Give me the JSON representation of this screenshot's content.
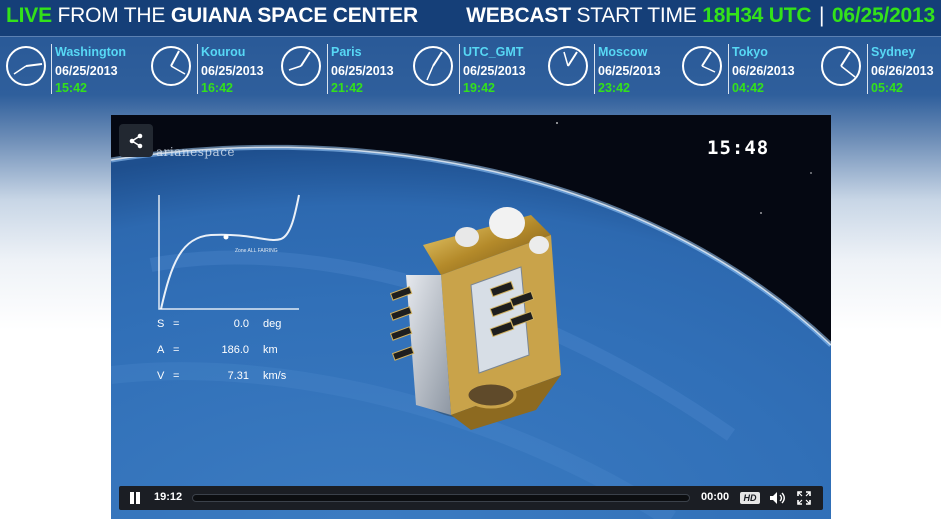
{
  "header": {
    "live": "LIVE",
    "from": "FROM THE",
    "place": "GUIANA SPACE CENTER",
    "webcast": "WEBCAST",
    "start_time_label": "START TIME",
    "start_time": "18H34 UTC",
    "separator": "|",
    "date": "06/25/2013"
  },
  "clocks": [
    {
      "city": "Washington",
      "date": "06/25/2013",
      "time": "15:42"
    },
    {
      "city": "Kourou",
      "date": "06/25/2013",
      "time": "16:42"
    },
    {
      "city": "Paris",
      "date": "06/25/2013",
      "time": "21:42"
    },
    {
      "city": "UTC_GMT",
      "date": "06/25/2013",
      "time": "19:42"
    },
    {
      "city": "Moscow",
      "date": "06/25/2013",
      "time": "23:42"
    },
    {
      "city": "Tokyo",
      "date": "06/26/2013",
      "time": "04:42"
    },
    {
      "city": "Sydney",
      "date": "06/26/2013",
      "time": "05:42"
    }
  ],
  "player": {
    "overlay_timer": "15:48",
    "brand": "arianespace",
    "graph_label": "Zone ALL FAIRING",
    "telemetry": [
      {
        "key": "S",
        "eq": "=",
        "value": "0.0",
        "unit": "deg"
      },
      {
        "key": "A",
        "eq": "=",
        "value": "186.0",
        "unit": "km"
      },
      {
        "key": "V",
        "eq": "=",
        "value": "7.31",
        "unit": "km/s"
      }
    ],
    "controls": {
      "elapsed": "19:12",
      "duration": "00:00",
      "hd_label": "HD"
    }
  },
  "colors": {
    "accent_green": "#33e21a",
    "city_cyan": "#57d8f5",
    "header_bg": "#153f78"
  },
  "icons": [
    "clock-icon",
    "share-icon",
    "pause-icon",
    "volume-icon",
    "fullscreen-icon"
  ]
}
